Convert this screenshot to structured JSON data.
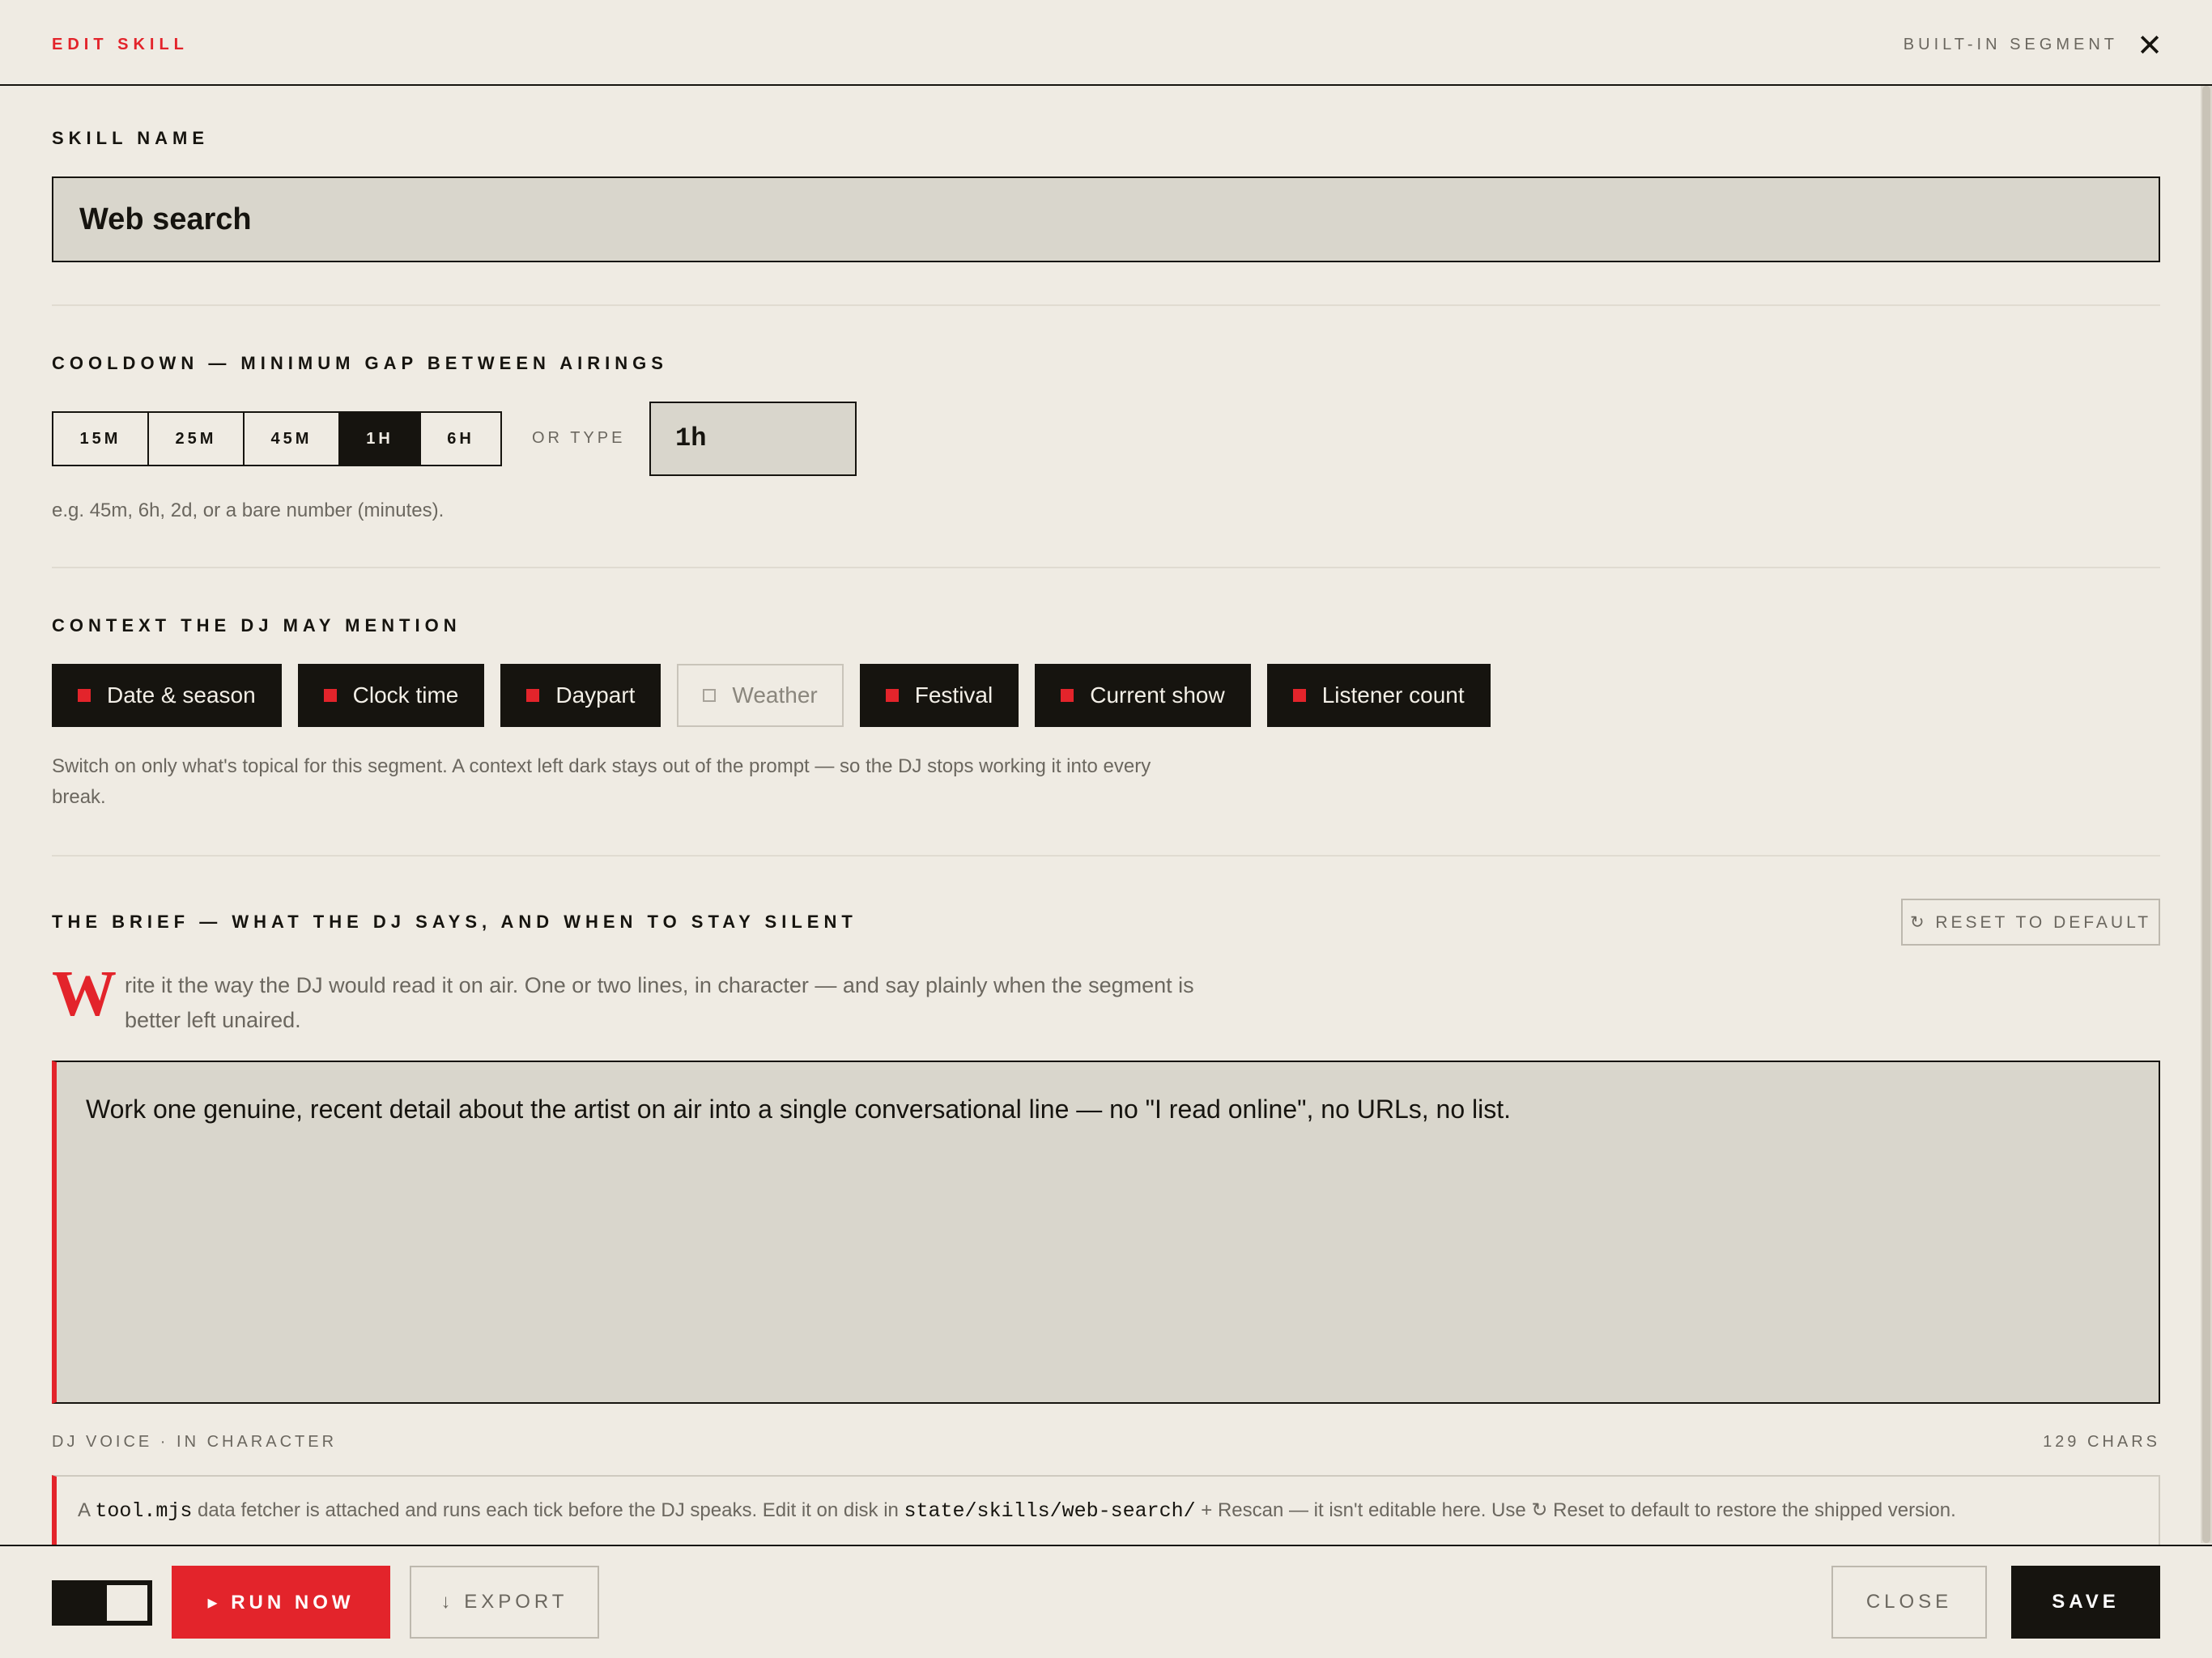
{
  "header": {
    "title": "EDIT SKILL",
    "kind": "BUILT-IN SEGMENT",
    "close_glyph": "✕"
  },
  "skill_name": {
    "label": "SKILL NAME",
    "value": "Web search"
  },
  "cooldown": {
    "label": "COOLDOWN — MINIMUM GAP BETWEEN AIRINGS",
    "presets": [
      "15M",
      "25M",
      "45M",
      "1H",
      "6H"
    ],
    "selected": "1H",
    "or_type_label": "OR TYPE",
    "value": "1h",
    "hint": "e.g. 45m, 6h, 2d, or a bare number (minutes)."
  },
  "context": {
    "label": "CONTEXT THE DJ MAY MENTION",
    "chips": [
      {
        "label": "Date & season",
        "on": true
      },
      {
        "label": "Clock time",
        "on": true
      },
      {
        "label": "Daypart",
        "on": true
      },
      {
        "label": "Weather",
        "on": false
      },
      {
        "label": "Festival",
        "on": true
      },
      {
        "label": "Current show",
        "on": true
      },
      {
        "label": "Listener count",
        "on": true
      }
    ],
    "hint": "Switch on only what's topical for this segment. A context left dark stays out of the prompt — so the DJ stops working it into every break."
  },
  "brief": {
    "label": "THE BRIEF — WHAT THE DJ SAYS, AND WHEN TO STAY SILENT",
    "reset_label": "↻ RESET TO DEFAULT",
    "dropcap": "W",
    "intro": "rite it the way the DJ would read it on air. One or two lines, in character — and say plainly when the segment is better left unaired.",
    "text": "Work one genuine, recent detail about the artist on air into a single conversational line — no \"I read online\", no URLs, no list.",
    "meta_left": "DJ VOICE · IN CHARACTER",
    "meta_right": "129 CHARS"
  },
  "notice": {
    "p1": "A ",
    "code1": "tool.mjs",
    "p2": " data fetcher is attached and runs each tick before the DJ speaks. Edit it on disk in ",
    "code2": "state/skills/web-search/",
    "p3": " + Rescan — it isn't editable here. Use ↻ Reset to default to restore the shipped version."
  },
  "footer": {
    "toggle_on": true,
    "run_label": "▸ RUN NOW",
    "export_label": "↓ EXPORT",
    "close_label": "CLOSE",
    "save_label": "SAVE"
  },
  "colors": {
    "accent": "#e3242b",
    "ink": "#16140f",
    "paper": "#efebe3",
    "field": "#d9d6cc"
  }
}
